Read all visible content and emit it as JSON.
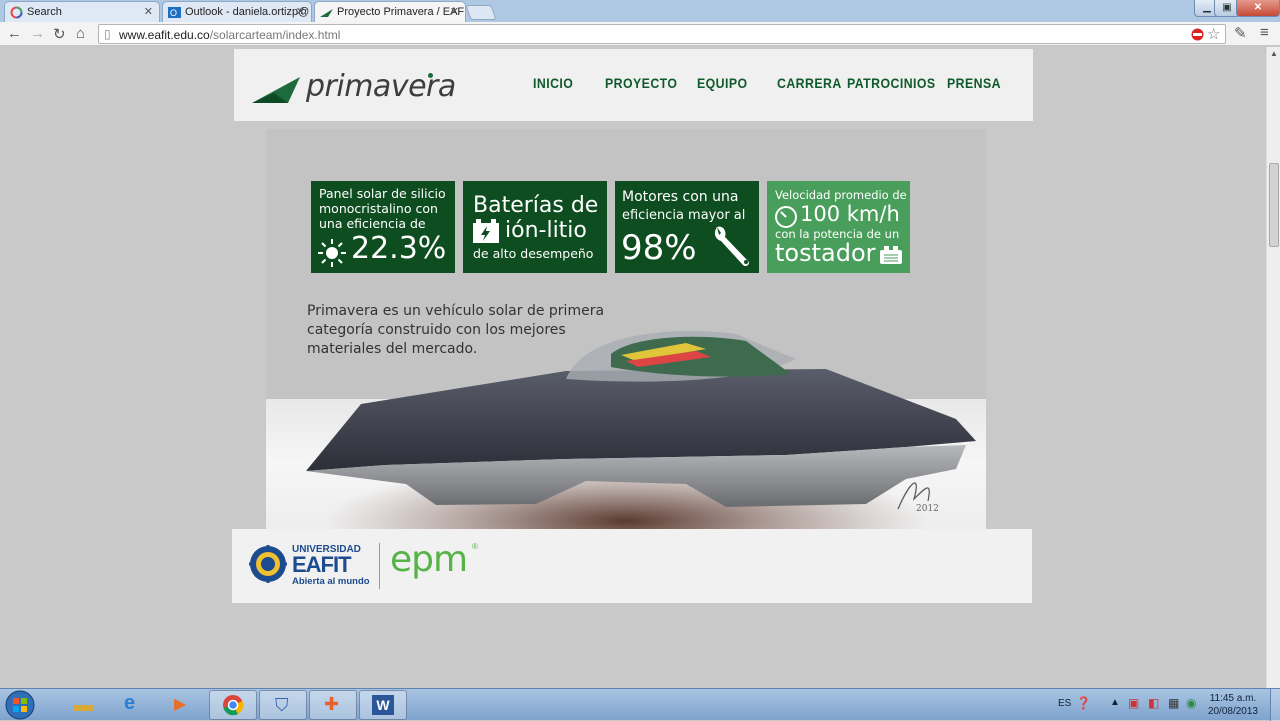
{
  "browser": {
    "tabs": [
      {
        "title": "Search"
      },
      {
        "title": "Outlook - daniela.ortizp@"
      },
      {
        "title": "Proyecto Primavera / EAFI"
      }
    ],
    "url_domain": "www.eafit.edu.co",
    "url_path": "/solarcarteam/index.html",
    "colors": {
      "accent": "#0e4d20",
      "tab_bar": "#aec8e4"
    }
  },
  "site": {
    "logo_text": "primavera",
    "nav": [
      "INICIO",
      "PROYECTO",
      "EQUIPO",
      "CARRERA",
      "PATROCINIOS",
      "PRENSA"
    ]
  },
  "features": [
    {
      "line1": "Panel solar de silicio",
      "line2": "monocristalino con",
      "line3": "una eficiencia de",
      "big": "22.3%",
      "icon": "sun-icon"
    },
    {
      "line1": "Baterías de",
      "line2": "ión-litio",
      "line3": "de alto desempeño",
      "icon": "battery-icon"
    },
    {
      "line1": "Motores con una",
      "line2": "eficiencia mayor al",
      "big": "98%",
      "icon": "wrench-icon"
    },
    {
      "line1": "Velocidad promedio de",
      "big": "100 km/h",
      "line2": "con la potencia de un",
      "line3": "tostador",
      "icon": "toaster-icon"
    }
  ],
  "hero": {
    "description": "Primavera es un vehículo solar de primera categoría construido con los mejores materiales del mercado.",
    "signature_year": "2012"
  },
  "sponsors": {
    "eafit_line1": "UNIVERSIDAD",
    "eafit_line2": "EAFIT",
    "eafit_tagline": "Abierta al mundo",
    "epm": "epm"
  },
  "taskbar": {
    "lang": "ES",
    "time": "11:45 a.m.",
    "date": "20/08/2013"
  }
}
